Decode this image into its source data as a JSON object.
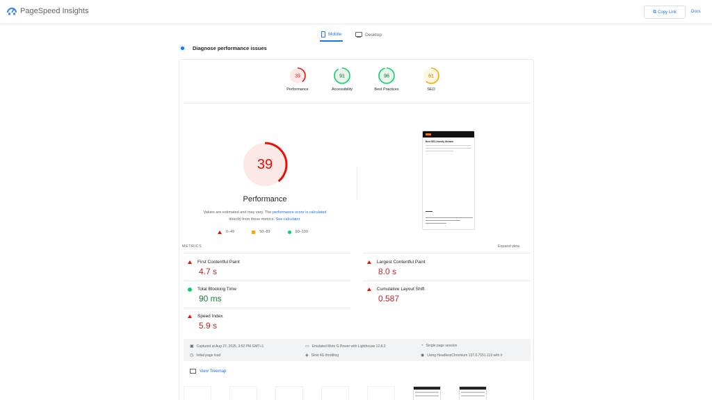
{
  "header": {
    "app_title": "PageSpeed Insights",
    "copy_link_label": "Copy Link",
    "docs_label": "Docs"
  },
  "tabs": [
    {
      "label": "Mobile",
      "active": true
    },
    {
      "label": "Desktop",
      "active": false
    }
  ],
  "section_title": "Diagnose performance issues",
  "categories": [
    {
      "score": "39",
      "label": "Performance",
      "color": "#eb0f00",
      "fraction": 0.39
    },
    {
      "score": "91",
      "label": "Accessibility",
      "color": "#0cce6b",
      "fraction": 0.91
    },
    {
      "score": "96",
      "label": "Best Practices",
      "color": "#0cce6b",
      "fraction": 0.96
    },
    {
      "score": "61",
      "label": "SEO",
      "color": "#ffa400",
      "fraction": 0.61
    }
  ],
  "performance": {
    "score": "39",
    "title": "Performance",
    "note_prefix": "Values are estimated and may vary. The ",
    "note_link1": "performance score is calculated",
    "note_middle": " directly from these metrics. ",
    "note_link2": "See calculator."
  },
  "legend": [
    {
      "label": "0–49",
      "shape": "triangle",
      "color": "#eb0f00"
    },
    {
      "label": "50–89",
      "shape": "square",
      "color": "#ffa400"
    },
    {
      "label": "90–100",
      "shape": "circle",
      "color": "#0cce6b"
    }
  ],
  "metrics_header": {
    "label": "METRICS",
    "expand_label": "Expand view"
  },
  "metrics": [
    {
      "name": "First Contentful Paint",
      "value": "4.7 s",
      "status": "poor"
    },
    {
      "name": "Largest Contentful Paint",
      "value": "8.0 s",
      "status": "poor"
    },
    {
      "name": "Total Blocking Time",
      "value": "90 ms",
      "status": "good"
    },
    {
      "name": "Cumulative Layout Shift",
      "value": "0.587",
      "status": "poor"
    },
    {
      "name": "Speed Index",
      "value": "5.9 s",
      "status": "poor"
    }
  ],
  "info": [
    {
      "icon": "calendar-icon",
      "text": "Captured at Aug 27, 2025, 3:52 PM GMT+1"
    },
    {
      "icon": "device-icon",
      "text": "Emulated Moto G Power with Lighthouse 12.8.0"
    },
    {
      "icon": "user-icon",
      "text": "Single page session"
    },
    {
      "icon": "timer-icon",
      "text": "Initial page load"
    },
    {
      "icon": "network-icon",
      "text": "Slow 4G throttling"
    },
    {
      "icon": "browser-icon",
      "text": "Using HeadlessChromium 137.0.7151.119 with lr"
    }
  ],
  "treemap_label": "View Treemap",
  "screenshot": {
    "heading": "Best SEO-friendly Website"
  }
}
